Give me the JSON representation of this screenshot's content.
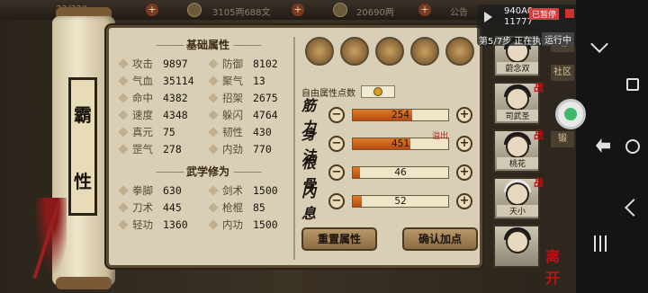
{
  "topbar": {
    "level": "22/320",
    "money": "3105两688文",
    "silver": "20690两",
    "announce": "公告"
  },
  "overlay": {
    "line1": "940A0",
    "line2": "11777",
    "line3": "第5/7步 正在执行",
    "pause": "已暂停",
    "running": "运行中"
  },
  "sidebar": {
    "labels": [
      "站",
      "社区",
      "锻"
    ]
  },
  "character": {
    "name_chars": [
      "霸",
      "性"
    ]
  },
  "basic_attrs": {
    "title": "基础属性",
    "items": [
      {
        "label": "攻击",
        "value": "9897"
      },
      {
        "label": "防御",
        "value": "8102"
      },
      {
        "label": "气血",
        "value": "35114"
      },
      {
        "label": "聚气",
        "value": "13"
      },
      {
        "label": "命中",
        "value": "4382"
      },
      {
        "label": "招架",
        "value": "2675"
      },
      {
        "label": "速度",
        "value": "4348"
      },
      {
        "label": "躲闪",
        "value": "4764"
      },
      {
        "label": "真元",
        "value": "75"
      },
      {
        "label": "韧性",
        "value": "430"
      },
      {
        "label": "罡气",
        "value": "278"
      },
      {
        "label": "内劲",
        "value": "770"
      }
    ]
  },
  "martial": {
    "title": "武学修为",
    "items": [
      {
        "label": "拳脚",
        "value": "630"
      },
      {
        "label": "剑术",
        "value": "1500"
      },
      {
        "label": "刀术",
        "value": "445"
      },
      {
        "label": "枪棍",
        "value": "85"
      },
      {
        "label": "轻功",
        "value": "1360"
      },
      {
        "label": "内功",
        "value": "1500"
      }
    ]
  },
  "free_points": {
    "label": "自由属性点数"
  },
  "attributes": [
    {
      "name": "筋力",
      "value": "254",
      "fill": 0.62
    },
    {
      "name": "身法",
      "value": "451",
      "fill": 0.6,
      "overflow": "溢出"
    },
    {
      "name": "根骨",
      "value": "46",
      "fill": 0.08
    },
    {
      "name": "内息",
      "value": "52",
      "fill": 0.09
    }
  ],
  "buttons": {
    "reset": "重置属性",
    "confirm": "确认加点"
  },
  "roster": [
    {
      "name": "蔚念双"
    },
    {
      "name": "司武圣",
      "war": "战"
    },
    {
      "name": "桃花",
      "war": "战"
    },
    {
      "name": "天小",
      "war": "战"
    },
    {
      "name": ""
    }
  ],
  "seal": "离开"
}
